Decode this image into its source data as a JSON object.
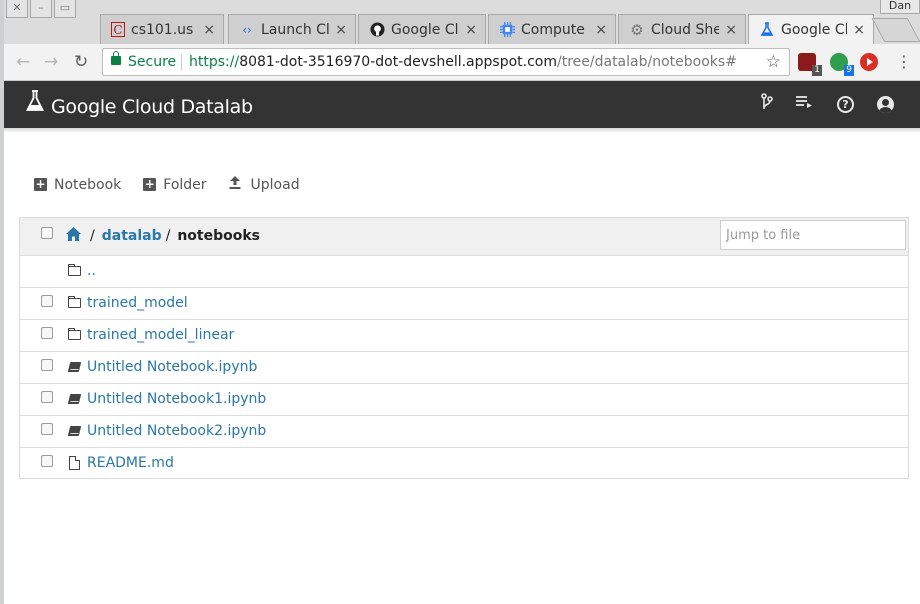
{
  "browser": {
    "tabs": [
      {
        "label": "cs101.us",
        "icon": "letter-c-icon"
      },
      {
        "label": "Launch Cl",
        "icon": "code-brackets-icon"
      },
      {
        "label": "Google Cl",
        "icon": "github-icon"
      },
      {
        "label": "Compute",
        "icon": "chip-icon"
      },
      {
        "label": "Cloud She",
        "icon": "gear-icon"
      },
      {
        "label": "Google Cl",
        "icon": "flask-icon"
      }
    ],
    "tab_close": "×",
    "user_label": "Dan",
    "address": {
      "secure_label": "Secure",
      "url_scheme": "https://",
      "url_host": "8081-dot-3516970-dot-devshell.appspot.com",
      "url_path": "/tree/datalab/notebooks#"
    },
    "extensions": [
      {
        "name": "ublock-icon",
        "badge": "1",
        "color": "#8b1a1a"
      },
      {
        "name": "green-dot-icon",
        "badge": "9",
        "color": "#2e9e4f"
      },
      {
        "name": "record-icon",
        "badge": "",
        "color": "#d93025"
      }
    ]
  },
  "app": {
    "title": "Google Cloud Datalab",
    "header_icons": [
      "git-branch-icon",
      "list-icon",
      "help-icon",
      "account-icon"
    ]
  },
  "actions": {
    "notebook": "Notebook",
    "folder": "Folder",
    "upload": "Upload"
  },
  "breadcrumb": {
    "slash": "/",
    "parent": "datalab",
    "current": "notebooks"
  },
  "jump": {
    "placeholder": "Jump to file"
  },
  "files": [
    {
      "name": "..",
      "type": "folder",
      "checkbox": false
    },
    {
      "name": "trained_model",
      "type": "folder",
      "checkbox": true
    },
    {
      "name": "trained_model_linear",
      "type": "folder",
      "checkbox": true
    },
    {
      "name": "Untitled Notebook.ipynb",
      "type": "notebook",
      "checkbox": true
    },
    {
      "name": "Untitled Notebook1.ipynb",
      "type": "notebook",
      "checkbox": true
    },
    {
      "name": "Untitled Notebook2.ipynb",
      "type": "notebook",
      "checkbox": true
    },
    {
      "name": "README.md",
      "type": "file",
      "checkbox": true
    }
  ]
}
